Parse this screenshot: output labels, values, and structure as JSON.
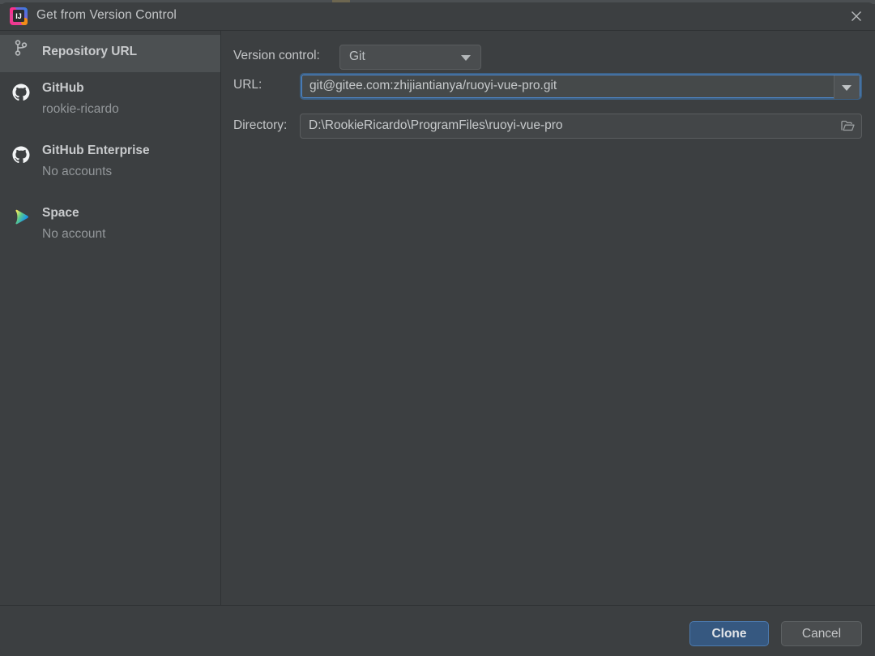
{
  "window": {
    "title": "Get from Version Control",
    "app_icon": "intellij-idea-icon",
    "close_label": "✕"
  },
  "sidebar": {
    "items": [
      {
        "label": "Repository URL",
        "sub": "",
        "icon": "git-branch-icon",
        "selected": true
      },
      {
        "label": "GitHub",
        "sub": "rookie-ricardo",
        "icon": "github-icon",
        "selected": false
      },
      {
        "label": "GitHub Enterprise",
        "sub": "No accounts",
        "icon": "github-icon",
        "selected": false
      },
      {
        "label": "Space",
        "sub": "No account",
        "icon": "jetbrains-space-icon",
        "selected": false
      }
    ]
  },
  "form": {
    "version_control": {
      "label": "Version control:",
      "value": "Git",
      "options": [
        "Git"
      ]
    },
    "url": {
      "label": "URL:",
      "value": "git@gitee.com:zhijiantianya/ruoyi-vue-pro.git",
      "placeholder": "",
      "focused": true
    },
    "directory": {
      "label": "Directory:",
      "value": "D:\\RookieRicardo\\ProgramFiles\\ruoyi-vue-pro",
      "placeholder": "",
      "browse_icon": "folder-icon"
    }
  },
  "footer": {
    "clone_label": "Clone",
    "cancel_label": "Cancel"
  },
  "colors": {
    "dialog_bg": "#3c3f41",
    "selected_row": "#4c5052",
    "accent_blue": "#365880",
    "focus_border": "#4e8ad0",
    "text_primary": "#c3c5c7",
    "text_secondary": "#93979a"
  }
}
